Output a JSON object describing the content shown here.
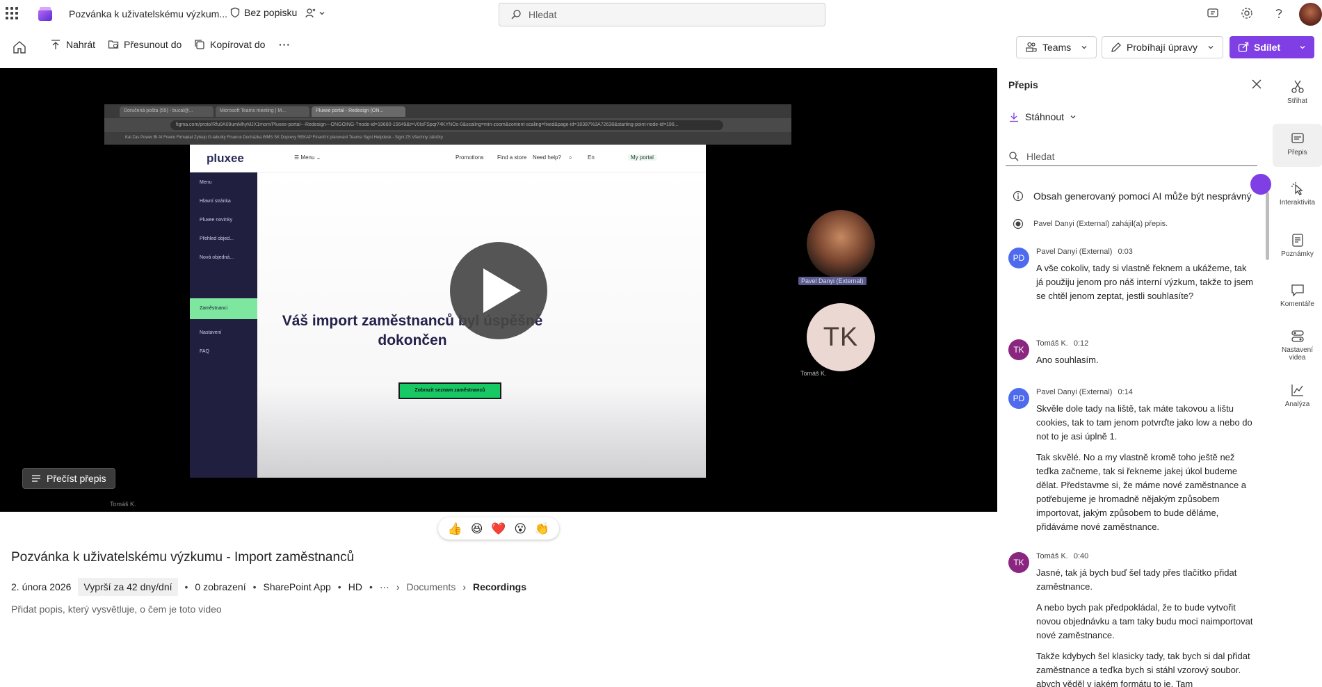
{
  "topbar": {
    "doc_title": "Pozvánka k uživatelskému výzkum...",
    "sensitivity": "Bez popisku",
    "search_placeholder": "Hledat"
  },
  "commands": {
    "upload": "Nahrát",
    "move": "Přesunout do",
    "copy": "Kopírovat do",
    "more": "···",
    "teams": "Teams",
    "editing": "Probíhají úpravy",
    "share": "Sdílet"
  },
  "video": {
    "read_transcript": "Přečíst přepis",
    "participants": [
      {
        "name": "Pavel Danyi (External)"
      },
      {
        "name": "Tomáš K.",
        "initials": "TK"
      }
    ],
    "screen": {
      "tabs": [
        "Doručená pošta (55) - bucal@...",
        "Microsoft Teams meeting | M...",
        "Pluxee portal - Redesign (ON..."
      ],
      "url": "figma.com/proto/Rfu0A09umMhyMJX1mom/Pluxee-portal---Redesign---ONGOING-?node-id=19680-15649&t=V0IsFSpqr74KYNOs-0&scaling=min-zoom&content-scaling=fixed&page-id=18387%3A72638&starting-point-node-id=196...",
      "bookmarks": "Kal  Zas  Power BI  AI  Freelo  Firmadat  Zyteqo  G-tabulky  Finance  Docházka  WMS  SK  Doprevy  REKAP  Finanční plánování  Teamsi  Signi  Helpdesk - Signi  ZS  Všechny záložky",
      "brand": "pluxee",
      "menu": "Menu",
      "nav": [
        "Promotions",
        "Find a store",
        "Need help?",
        "En",
        "My portal"
      ],
      "sidebar": [
        "Menu",
        "Hlavní stránka",
        "Pluxee novinky",
        "Přehled objed...",
        "Nová objedná...",
        "Zaměstnanci",
        "Nastavení",
        "FAQ"
      ],
      "message": "Váš import zaměstnanců byl úspěšně dokončen",
      "button": "Zobrazit seznam zaměstnanců"
    },
    "bottom_label": "Tomáš K."
  },
  "reactions": [
    "👍",
    "😆",
    "❤️",
    "😮",
    "👏"
  ],
  "details": {
    "title": "Pozvánka k uživatelskému výzkumu - Import zaměstnanců",
    "date": "2. února 2026",
    "expires": "Vyprší za 42 dny/dní",
    "views": "0 zobrazení",
    "app": "SharePoint App",
    "quality": "HD",
    "more": "···",
    "crumb1": "Documents",
    "crumb2": "Recordings",
    "description_placeholder": "Přidat popis, který vysvětluje, o čem je toto video"
  },
  "transcript": {
    "title": "Přepis",
    "download": "Stáhnout",
    "search_placeholder": "Hledat",
    "ai_note": "Obsah generovaný pomocí AI může být nesprávný",
    "start_note": "Pavel Danyi (External) zahájil(a) přepis.",
    "entries": [
      {
        "initials": "PD",
        "speaker": "Pavel Danyi (External)",
        "time": "0:03",
        "color": "#4f6bed",
        "paragraphs": [
          "A vše cokoliv, tady si vlastně řeknem a ukážeme, tak já použiju jenom pro náš interní výzkum, takže to jsem se chtěl jenom zeptat, jestli souhlasíte?"
        ]
      },
      {
        "initials": "TK",
        "speaker": "Tomáš K.",
        "time": "0:12",
        "color": "#8a2580",
        "paragraphs": [
          "Ano souhlasím."
        ]
      },
      {
        "initials": "PD",
        "speaker": "Pavel Danyi (External)",
        "time": "0:14",
        "color": "#4f6bed",
        "paragraphs": [
          "Skvěle dole tady na liště, tak máte takovou a lištu cookies, tak to tam jenom potvrďte jako low a nebo do not to je asi úplně 1.",
          "Tak skvělé. No a my vlastně kromě toho ještě než teďka začneme, tak si řekneme jakej úkol budeme dělat. Představme si, že máme nové zaměstnance a potřebujeme je hromadně nějakým způsobem importovat, jakým způsobem to bude děláme, přidáváme nové zaměstnance."
        ]
      },
      {
        "initials": "TK",
        "speaker": "Tomáš K.",
        "time": "0:40",
        "color": "#8a2580",
        "paragraphs": [
          "Jasné, tak já bych buď šel tady přes tlačítko přidat zaměstnance.",
          "A nebo bych pak předpokládal, že to bude vytvořit novou objednávku a tam taky budu moci naimportovat nové zaměstnance.",
          "Takže kdybych šel klasicky tady, tak bych si dal přidat zaměstnance a teďka bych si stáhl vzorový soubor. abvch věděl v iakém formátu to ie. Tam"
        ]
      }
    ]
  },
  "rail": [
    {
      "label": "Střihat",
      "icon": "scissors-icon"
    },
    {
      "label": "Přepis",
      "icon": "transcript-icon"
    },
    {
      "label": "Interaktivita",
      "icon": "pointer-icon"
    },
    {
      "label": "Poznámky",
      "icon": "notes-icon"
    },
    {
      "label": "Komentáře",
      "icon": "comment-icon"
    },
    {
      "label": "Nastavení videa",
      "icon": "video-settings-icon"
    },
    {
      "label": "Analýza",
      "icon": "analytics-icon"
    }
  ]
}
